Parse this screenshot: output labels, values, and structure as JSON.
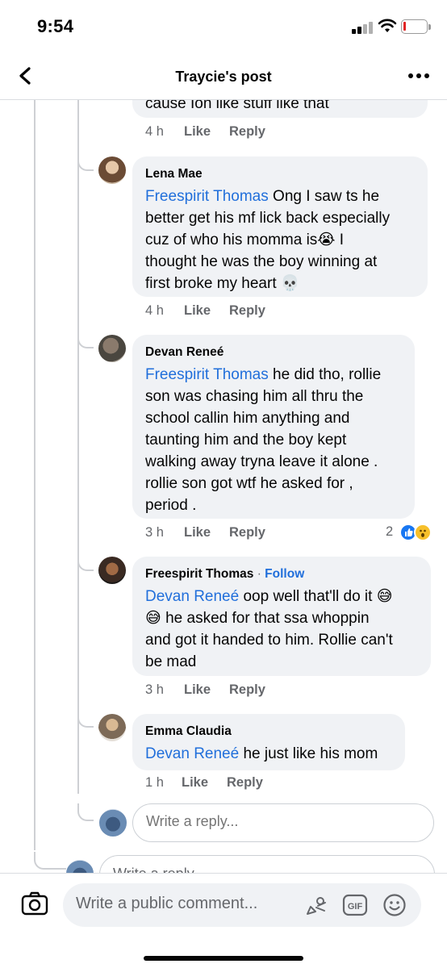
{
  "status_bar": {
    "time": "9:54"
  },
  "nav": {
    "title": "Traycie's post"
  },
  "partial_comment": {
    "text": "cause Ion like stuff like that",
    "time": "4 h",
    "like": "Like",
    "reply": "Reply"
  },
  "comments": [
    {
      "author": "Lena Mae",
      "mention": "Freespirit Thomas",
      "lines": [
        "Ong I saw ts he",
        "better get his mf lick back especially",
        "cuz of who his momma is😭 I",
        "thought he was the boy winning at",
        "first broke my heart 💀"
      ],
      "time": "4 h",
      "like": "Like",
      "reply": "Reply"
    },
    {
      "author": "Devan Reneé",
      "mention": "Freespirit Thomas",
      "lines": [
        "he did tho, rollie",
        "son was chasing him all thru the",
        "school callin him anything and",
        "taunting him and the boy kept",
        "walking away tryna leave it alone .",
        "rollie son got wtf he asked for ,",
        "period ."
      ],
      "time": "3 h",
      "like": "Like",
      "reply": "Reply",
      "reaction_count": "2"
    },
    {
      "author": "Freespirit Thomas",
      "follow": "Follow",
      "mention": "Devan Reneé",
      "lines": [
        "oop well that'll do it 😅",
        "😅 he asked for that ssa whoppin",
        "and got it handed to him. Rollie can't",
        "be mad"
      ],
      "time": "3 h",
      "like": "Like",
      "reply": "Reply"
    },
    {
      "author": "Emma Claudia",
      "mention": "Devan Reneé",
      "lines": [
        "he just like his mom"
      ],
      "time": "1 h",
      "like": "Like",
      "reply": "Reply"
    }
  ],
  "reply_input": {
    "placeholder": "Write a reply..."
  },
  "reply_input_partial": {
    "placeholder": "Write a reply..."
  },
  "composer": {
    "placeholder": "Write a public comment..."
  },
  "colors": {
    "accent": "#216fdb",
    "bubble": "#f0f2f5",
    "secondary_text": "#65676b"
  },
  "icons": [
    "back-chevron-icon",
    "more-icon",
    "camera-icon",
    "avatar-sticker-icon",
    "gif-icon",
    "emoji-icon",
    "like-reaction-icon",
    "wow-reaction-icon"
  ]
}
